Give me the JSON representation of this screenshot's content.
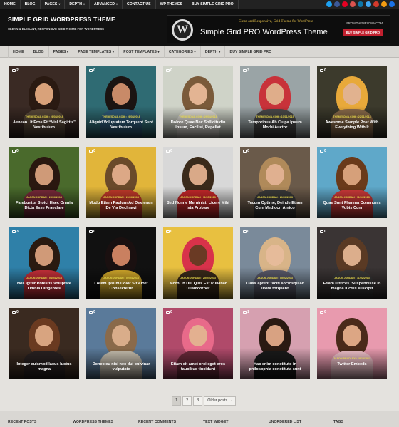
{
  "topnav": {
    "items": [
      {
        "label": "HOME",
        "caret": false
      },
      {
        "label": "BLOG",
        "caret": false
      },
      {
        "label": "PAGES",
        "caret": true
      },
      {
        "label": "DEPTH",
        "caret": true
      },
      {
        "label": "ADVANCED",
        "caret": true
      },
      {
        "label": "CONTACT US",
        "caret": false
      },
      {
        "label": "WP THEMES",
        "caret": false
      },
      {
        "label": "BUY SIMPLE GRID PRO",
        "caret": false
      }
    ],
    "social_colors": [
      "#1da1f2",
      "#3b5998",
      "#e60023",
      "#d9534f",
      "#0e76a8",
      "#3fa9f5",
      "#d33a2c",
      "#f39c12",
      "#1a73e8"
    ]
  },
  "header": {
    "site_title": "SIMPLE GRID WORDPRESS THEME",
    "site_description": "CLEAN & ELEGANT, RESPONSIVE GRID THEME FOR WORDPRESS",
    "banner": {
      "tagline": "Clean and Responsive, Grid Theme for WordPress",
      "title": "Simple Grid PRO WordPress Theme",
      "from": "FROM THEMESDNA.COM",
      "buy": "BUY SIMPLE GRID PRO",
      "logo_glyph": "W"
    }
  },
  "mainnav": {
    "items": [
      "HOME",
      "BLOG",
      "PAGES ▾",
      "PAGE TEMPLATES ▾",
      "POST TEMPLATES ▾",
      "CATEGORIES ▾",
      "DEPTH ▾",
      "BUY SIMPLE GRID PRO"
    ]
  },
  "posts": [
    {
      "comments": "2",
      "meta": "THEMESDNA.COM  •  28/04/2018",
      "title": "Aenean Ut Eros Et “Nisl Sagittis” Vestibulum",
      "bg": "#3a2a24",
      "hair": "#2a1a12",
      "skin": "#d9a27a",
      "body": "#5a4a3a"
    },
    {
      "comments": "0",
      "meta": "THEMESDNA.COM  •  28/04/2018",
      "title": "Aliquid Voluptatem Torquent Sunt Vestibulum",
      "bg": "#2f6b73",
      "hair": "#1b1412",
      "skin": "#c88a68",
      "body": "#2e5b7a"
    },
    {
      "comments": "0",
      "meta": "THEMESDNA.COM  •  26/04/2018",
      "title": "Dolore Quae Nec Sollicitudin Ipsum, Facilisi, Repellat",
      "bg": "#cfd3c8",
      "hair": "#7a5a3a",
      "skin": "#e3b493",
      "body": "#e9e6df"
    },
    {
      "comments": "3",
      "meta": "THEMESDNA.COM  •  10/11/2015",
      "title": "Temporibus Ab Culpa Ipsum Morbi Auctor",
      "bg": "#9aa4a6",
      "hair": "#c8323a",
      "skin": "#dfad8a",
      "body": "#4a4a4a"
    },
    {
      "comments": "0",
      "meta": "THEMESDNA.COM  •  22/11/2014",
      "title": "Awesome Sample Post With Everything With It",
      "bg": "#3c3a2c",
      "hair": "#e8a93a",
      "skin": "#e1b28f",
      "body": "#8a6a4a"
    },
    {
      "comments": "0",
      "meta": "JASON JORDAN  •  25/06/2013",
      "title": "Fatebuntur Stoici Haec Omnia Dicta Esse Praeclare",
      "bg": "#4a6a2c",
      "hair": "#2a1810",
      "skin": "#cf9a78",
      "body": "#7a2a3a"
    },
    {
      "comments": "0",
      "meta": "JASON JORDAN  •  21/06/2013",
      "title": "Modo Etiam Paulum Ad Dexteram De Via Declinavi",
      "bg": "#e1b53a",
      "hair": "#6a4a2a",
      "skin": "#dca886",
      "body": "#c43a2a"
    },
    {
      "comments": "0",
      "meta": "JASON JORDAN  •  11/05/2013",
      "title": "Sed Nonne Merninisti Licere Mihi Ista Probare",
      "bg": "#d8d8d8",
      "hair": "#3a2a1a",
      "skin": "#d9a988",
      "body": "#c8282a"
    },
    {
      "comments": "0",
      "meta": "JASON JORDAN  •  21/06/2013",
      "title": "Tecum Optime, Deinde Etiam Cum Mediocri Amico",
      "bg": "#6a5a4a",
      "hair": "#b08a5a",
      "skin": "#e0b090",
      "body": "#3a3a3a"
    },
    {
      "comments": "0",
      "meta": "JASON JORDAN  •  11/04/2013",
      "title": "Quae Sunt Flamma Commonis Vobis Cum",
      "bg": "#5fa8c9",
      "hair": "#6a3a1a",
      "skin": "#d6a07a",
      "body": "#d03a3a"
    },
    {
      "comments": "3",
      "meta": "JASON JORDAN  •  04/04/2013",
      "title": "Nos Igitur Potestis Voluptate Omnia Dirigentes",
      "bg": "#2f80a8",
      "hair": "#2a1a10",
      "skin": "#d09a78",
      "body": "#c8303a"
    },
    {
      "comments": "0",
      "meta": "JASON JORDAN  •  02/04/2013",
      "title": "Lorem Ipsum Dolor Sit Amet Consectetur",
      "bg": "#111111",
      "hair": "#1a1010",
      "skin": "#c98060",
      "body": "#d2a82a"
    },
    {
      "comments": "0",
      "meta": "JASON JORDAN  •  25/04/2013",
      "title": "Morbi In Dui Quis Est Pulvinar Ullamcorper",
      "bg": "#e8c040",
      "hair": "#d8324a",
      "skin": "#6a3a24",
      "body": "#3a2a1a"
    },
    {
      "comments": "0",
      "meta": "JASON JORDAN  •  05/02/2013",
      "title": "Class aptent taciti sociosqu ad litora torquent",
      "bg": "#7a8a9a",
      "hair": "#d8b488",
      "skin": "#e6bb9a",
      "body": "#5a5a6a"
    },
    {
      "comments": "0",
      "meta": "JASON JORDAN  •  11/02/2013",
      "title": "Etiam ultrices. Suspendisse in magna luctus suscipit",
      "bg": "#3a3434",
      "hair": "#5a3a24",
      "skin": "#dcae8c",
      "body": "#3a3a3a"
    },
    {
      "comments": "0",
      "meta": "",
      "title": "Integer euismod lacus luctus magna",
      "bg": "#3a2a20",
      "hair": "#6a3a20",
      "skin": "#d8a480",
      "body": "#2a2222"
    },
    {
      "comments": "0",
      "meta": "",
      "title": "Donec eu nisi nec dui pulvinar vulputate",
      "bg": "#5a7a9a",
      "hair": "#8a6a4a",
      "skin": "#d9ad8a",
      "body": "#c8c0b0"
    },
    {
      "comments": "0",
      "meta": "",
      "title": "Etiam sit amet orci eget eros faucibus tincidunt",
      "bg": "#b04a6a",
      "hair": "#e86a8a",
      "skin": "#e3b090",
      "body": "#6a2a3a"
    },
    {
      "comments": "1",
      "meta": "",
      "title": "Hac enim constituto in philosophia constituta sunt",
      "bg": "#d6a0b0",
      "hair": "#2a1a12",
      "skin": "#d8a282",
      "body": "#1a1a1a"
    },
    {
      "comments": "0",
      "meta": "JASON BRADLEY  •  18/10/2013",
      "title": "Twitter Embeds",
      "bg": "#e89aae",
      "hair": "#4a2a1a",
      "skin": "#dca684",
      "body": "#f3c4cc"
    }
  ],
  "pagination": {
    "pages": [
      "1",
      "2",
      "3"
    ],
    "next": "Older posts →"
  },
  "footer": {
    "widgets": [
      "RECENT POSTS",
      "WORDPRESS THEMES",
      "RECENT COMMENTS",
      "TEXT WIDGET",
      "UNORDERED LIST",
      "TAGS"
    ]
  }
}
